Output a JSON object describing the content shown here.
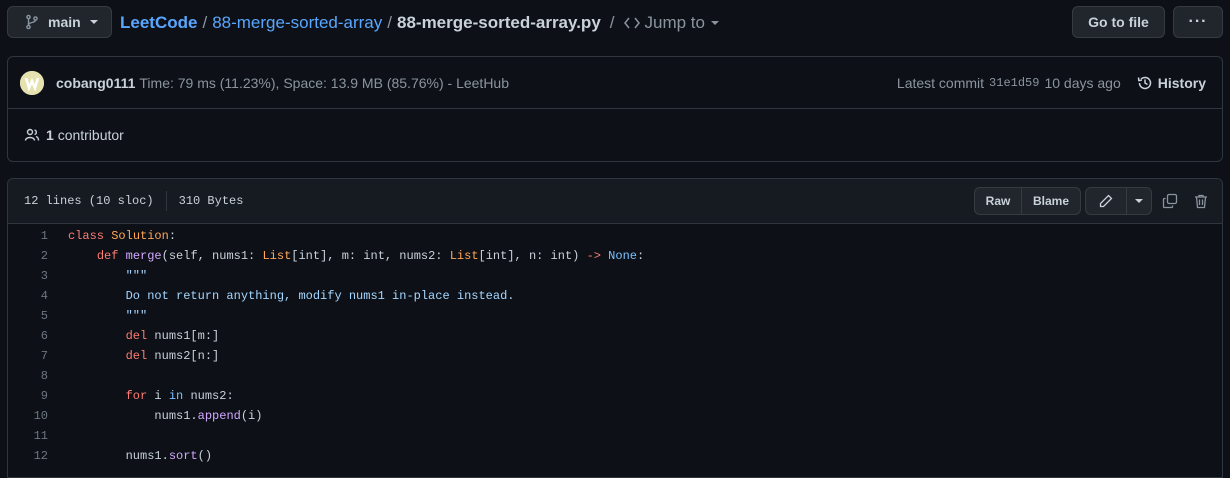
{
  "branch": {
    "name": "main"
  },
  "breadcrumb": {
    "repo": "LeetCode",
    "sep1": "/",
    "folder": "88-merge-sorted-array",
    "sep2": "/",
    "file": "88-merge-sorted-array.py",
    "sep3": "/",
    "jump_label": "Jump to"
  },
  "actions": {
    "go_to_file": "Go to file",
    "more": "···"
  },
  "commit": {
    "author": "cobang0111",
    "message": "Time: 79 ms (11.23%), Space: 13.9 MB (85.76%) - LeetHub",
    "latest_label": "Latest commit",
    "sha": "31e1d59",
    "time": "10 days ago",
    "history_label": "History"
  },
  "contributors": {
    "count": "1",
    "label": "contributor"
  },
  "file_info": {
    "lines": "12 lines (10 sloc)",
    "size": "310 Bytes"
  },
  "file_actions": {
    "raw": "Raw",
    "blame": "Blame"
  },
  "code": {
    "line_numbers": [
      "1",
      "2",
      "3",
      "4",
      "5",
      "6",
      "7",
      "8",
      "9",
      "10",
      "11",
      "12"
    ],
    "lines": [
      [
        {
          "t": "class ",
          "c": "k"
        },
        {
          "t": "Solution",
          "c": "n"
        },
        {
          "t": ":",
          "c": ""
        }
      ],
      [
        {
          "t": "    ",
          "c": ""
        },
        {
          "t": "def ",
          "c": "k"
        },
        {
          "t": "merge",
          "c": "f"
        },
        {
          "t": "(self, nums1: ",
          "c": ""
        },
        {
          "t": "List",
          "c": "n"
        },
        {
          "t": "[int], m: int, nums2: ",
          "c": ""
        },
        {
          "t": "List",
          "c": "n"
        },
        {
          "t": "[int], n: int) ",
          "c": ""
        },
        {
          "t": "-> ",
          "c": "k"
        },
        {
          "t": "None",
          "c": "c"
        },
        {
          "t": ":",
          "c": ""
        }
      ],
      [
        {
          "t": "        ",
          "c": ""
        },
        {
          "t": "\"\"\"",
          "c": "s"
        }
      ],
      [
        {
          "t": "        ",
          "c": ""
        },
        {
          "t": "Do not return anything, modify nums1 in-place instead.",
          "c": "s"
        }
      ],
      [
        {
          "t": "        ",
          "c": ""
        },
        {
          "t": "\"\"\"",
          "c": "s"
        }
      ],
      [
        {
          "t": "        ",
          "c": ""
        },
        {
          "t": "del ",
          "c": "k"
        },
        {
          "t": "nums1[m:]",
          "c": ""
        }
      ],
      [
        {
          "t": "        ",
          "c": ""
        },
        {
          "t": "del ",
          "c": "k"
        },
        {
          "t": "nums2[n:]",
          "c": ""
        }
      ],
      [],
      [
        {
          "t": "        ",
          "c": ""
        },
        {
          "t": "for ",
          "c": "k"
        },
        {
          "t": "i ",
          "c": ""
        },
        {
          "t": "in ",
          "c": "c"
        },
        {
          "t": "nums2:",
          "c": ""
        }
      ],
      [
        {
          "t": "            ",
          "c": ""
        },
        {
          "t": "nums1.",
          "c": ""
        },
        {
          "t": "append",
          "c": "f"
        },
        {
          "t": "(i)",
          "c": ""
        }
      ],
      [],
      [
        {
          "t": "        ",
          "c": ""
        },
        {
          "t": "nums1.",
          "c": ""
        },
        {
          "t": "sort",
          "c": "f"
        },
        {
          "t": "()",
          "c": ""
        }
      ]
    ]
  },
  "colors": {
    "background": "#0d1117",
    "link": "#58a6ff",
    "keyword": "#ff7b72",
    "class_name": "#ffa657",
    "function": "#d2a8ff",
    "constant": "#79c0ff",
    "string": "#a5d6ff"
  },
  "icons": [
    "git-branch-icon",
    "caret-down-icon",
    "code-icon",
    "history-icon",
    "people-icon",
    "pencil-icon",
    "copy-icon",
    "trash-icon"
  ]
}
